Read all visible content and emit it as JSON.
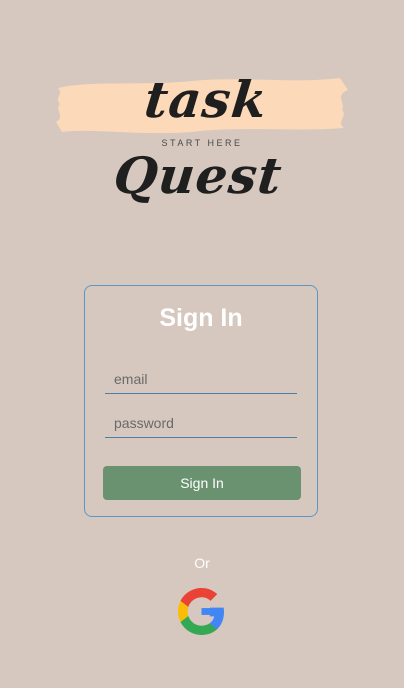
{
  "logo": {
    "title": "task Quest",
    "tagline": "START HERE"
  },
  "signin": {
    "title": "Sign In",
    "email_placeholder": "email",
    "password_placeholder": "password",
    "button_label": "Sign In"
  },
  "alt_login": {
    "or_label": "Or",
    "provider_icon": "google-icon"
  },
  "colors": {
    "background": "#d6c8bf",
    "card_border": "#5b97c4",
    "button": "#6a9270",
    "logo_brush": "#fcd9b8"
  }
}
